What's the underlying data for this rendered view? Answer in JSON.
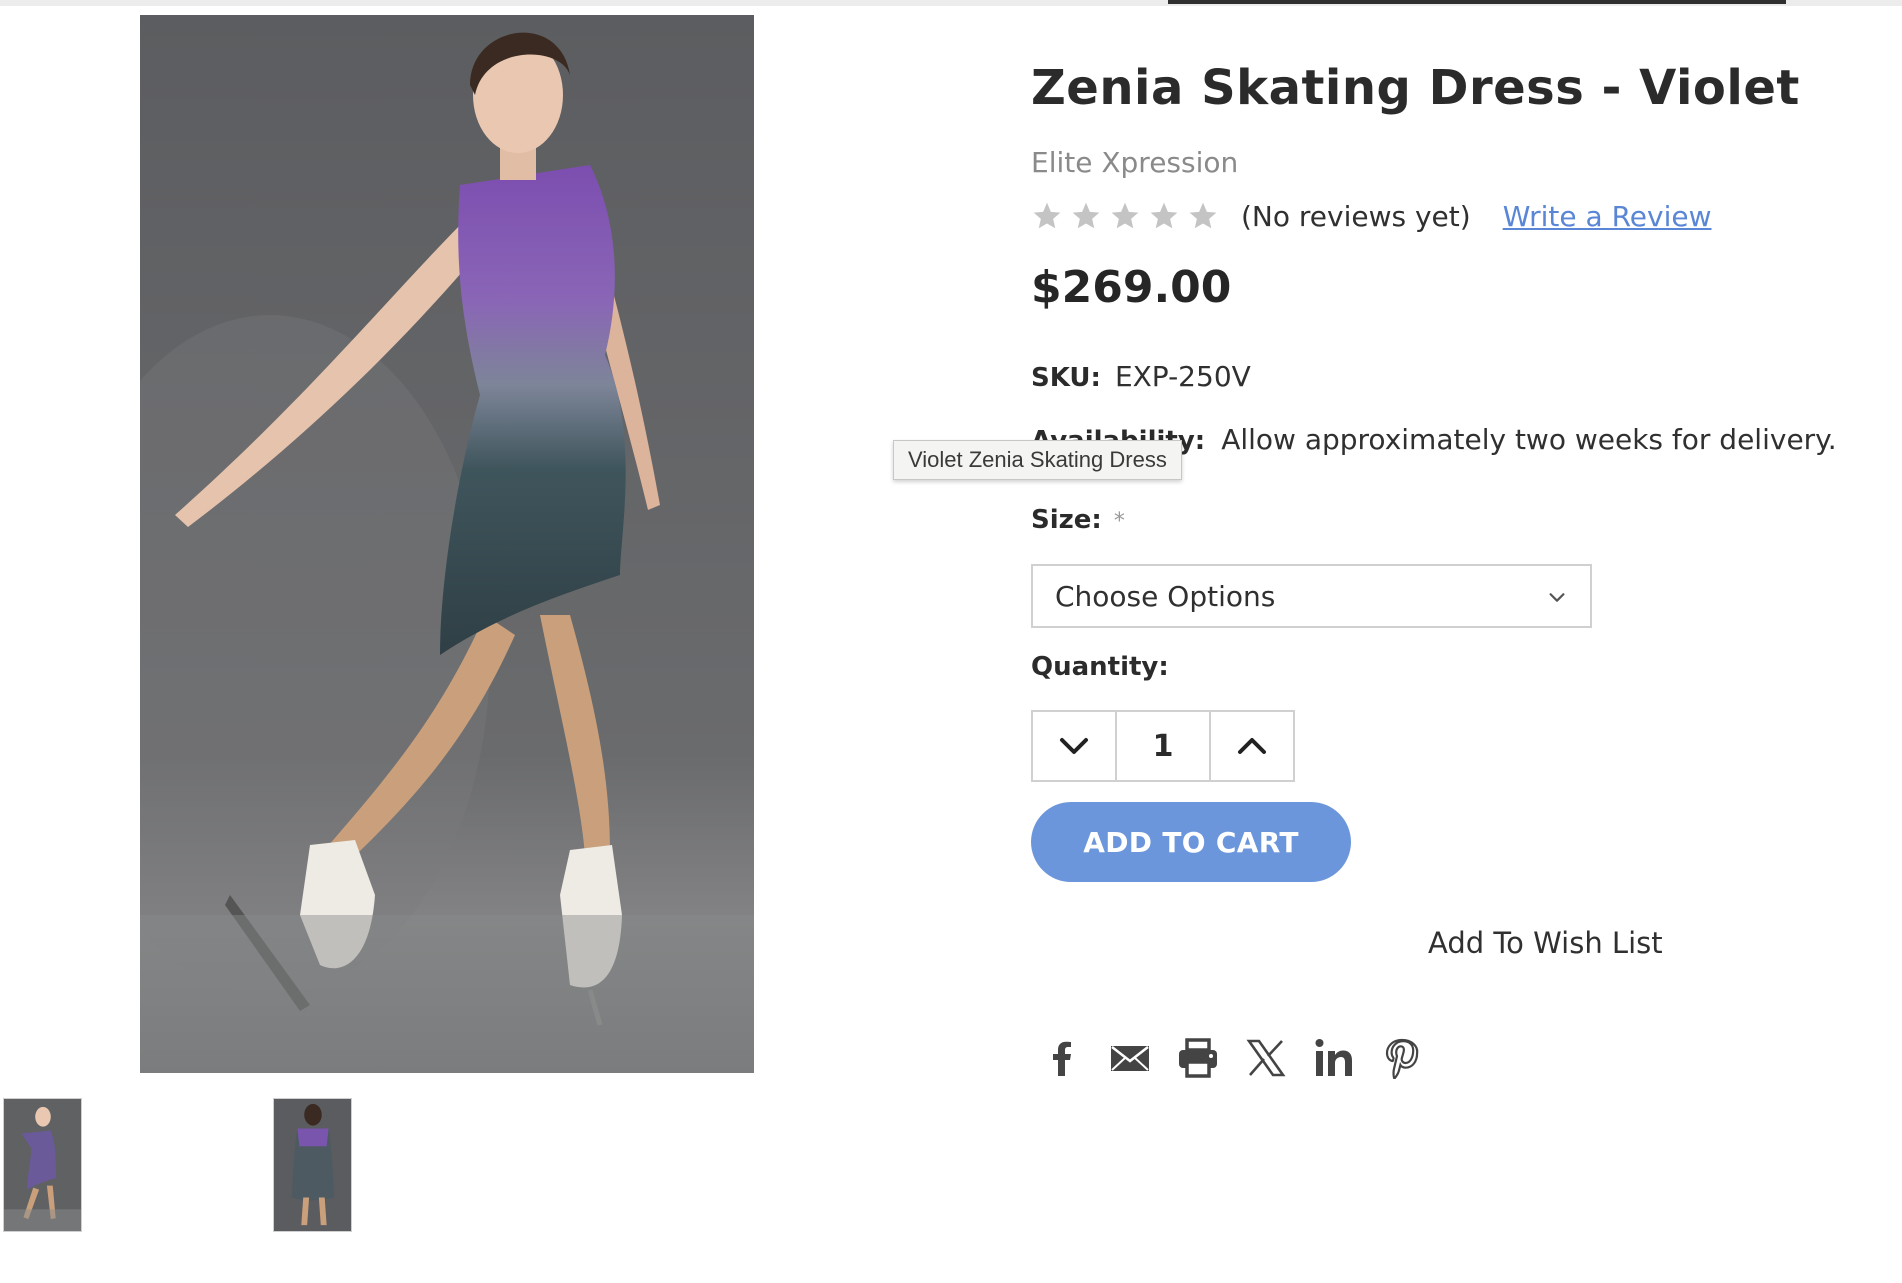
{
  "product": {
    "title": "Zenia Skating Dress - Violet",
    "brand": "Elite Xpression",
    "rating": {
      "stars": 5,
      "filled": 0,
      "reviews_text": "(No reviews yet)",
      "write_review": "Write a Review"
    },
    "price": "$269.00",
    "sku_label": "SKU:",
    "sku": "EXP-250V",
    "availability_label": "Availability:",
    "availability": "Allow approximately two weeks for delivery.",
    "size_label": "Size:",
    "required_mark": "*",
    "size_select": "Choose Options",
    "quantity_label": "Quantity:",
    "quantity": "1",
    "add_to_cart": "ADD TO CART",
    "wish_list": "Add To Wish List"
  },
  "gallery": {
    "tooltip": "Violet Zenia Skating Dress",
    "thumbnail_count": 2
  },
  "share_icons": [
    "facebook-icon",
    "email-icon",
    "print-icon",
    "x-icon",
    "linkedin-icon",
    "pinterest-icon"
  ],
  "colors": {
    "accent": "#6b96dc",
    "link": "#5a86d6",
    "star": "#c4c4c4",
    "dress": "#7b4ca8"
  }
}
